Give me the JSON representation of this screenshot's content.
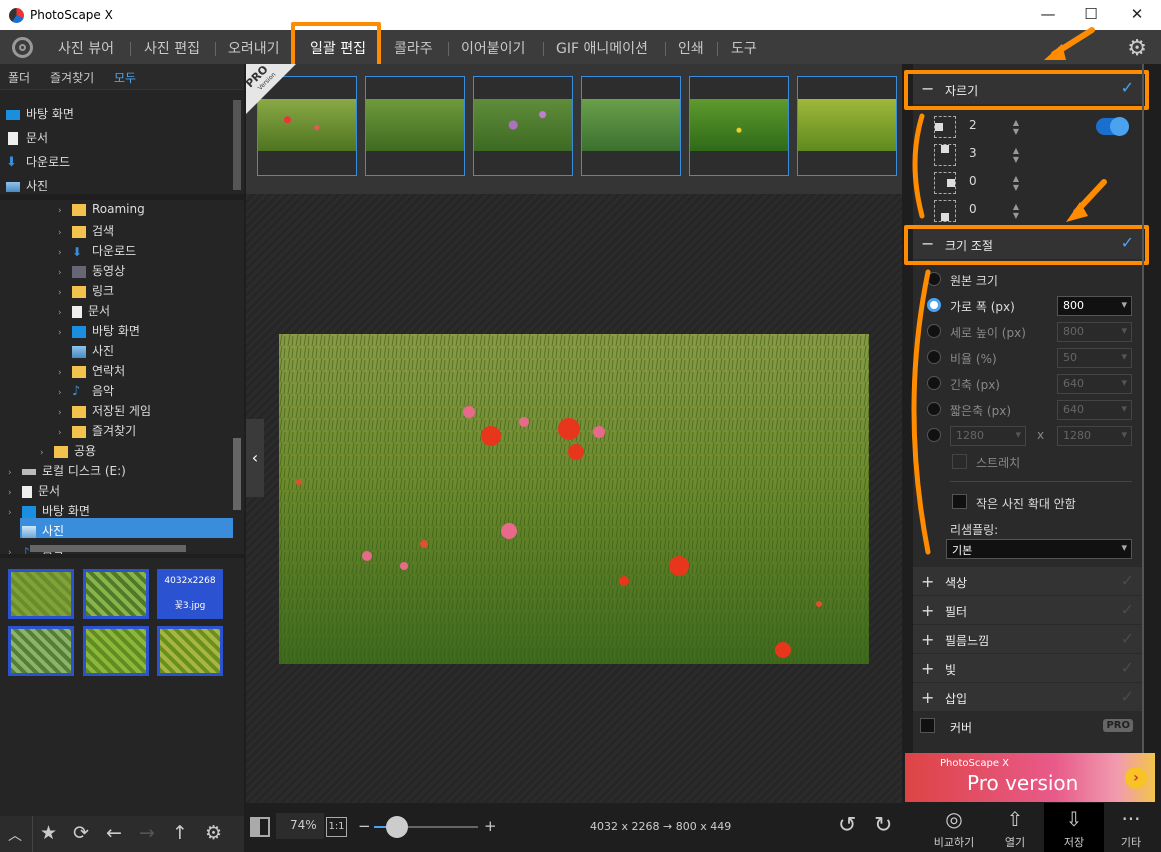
{
  "window": {
    "title": "PhotoScape X",
    "minimize": "—",
    "maximize": "☐",
    "close": "✕"
  },
  "menu": {
    "tabs": [
      "사진 뷰어",
      "사진 편집",
      "오려내기",
      "일괄 편집",
      "콜라주",
      "이어붙이기",
      "GIF 애니메이션",
      "인쇄",
      "도구"
    ],
    "active": "일괄 편집"
  },
  "left_panel": {
    "tabs": [
      "폴더",
      "즐겨찾기",
      "모두"
    ],
    "active_tab": "모두",
    "favorites": [
      "바탕 화면",
      "문서",
      "다운로드",
      "사진"
    ],
    "tree": [
      "Roaming",
      "검색",
      "다운로드",
      "동영상",
      "링크",
      "문서",
      "바탕 화면",
      "사진",
      "연락처",
      "음악",
      "저장된 게임",
      "즐겨찾기",
      "공용",
      "로컬 디스크 (E:)",
      "문서",
      "바탕 화면",
      "사진",
      "음악"
    ],
    "selected_item": "사진",
    "hover_thumb": {
      "size": "4032x2268",
      "name": "꽃3.jpg"
    }
  },
  "filmstrip": {
    "badge_pro": "PRO",
    "badge_version": "Version"
  },
  "bottom_center": {
    "zoom": "74%",
    "one_to_one": "1:1",
    "minus": "−",
    "plus": "+",
    "dimension_text": "4032 x 2268 → 800 x 449"
  },
  "right_panel": {
    "crop": {
      "title": "자르기",
      "values": [
        "2",
        "3",
        "0",
        "0"
      ]
    },
    "resize": {
      "title": "크기 조절",
      "options": [
        {
          "label": "원본 크기",
          "value": ""
        },
        {
          "label": "가로 폭 (px)",
          "value": "800"
        },
        {
          "label": "세로 높이 (px)",
          "value": "800"
        },
        {
          "label": "비율 (%)",
          "value": "50"
        },
        {
          "label": "긴축 (px)",
          "value": "640"
        },
        {
          "label": "짧은축 (px)",
          "value": "640"
        }
      ],
      "custom_w": "1280",
      "custom_x": "x",
      "custom_h": "1280",
      "stretch": "스트레치",
      "no_enlarge": "작은 사진 확대 안함",
      "resampling_label": "리샘플링:",
      "resampling_value": "기본"
    },
    "sections": [
      "색상",
      "필터",
      "필름느낌",
      "빛",
      "삽입"
    ],
    "cover": {
      "label": "커버",
      "badge": "PRO"
    },
    "banner": {
      "line1": "PhotoScape X",
      "line2": "Pro version"
    }
  },
  "bottom_right": {
    "compare": "비교하기",
    "open": "열기",
    "save": "저장",
    "more": "기타"
  }
}
